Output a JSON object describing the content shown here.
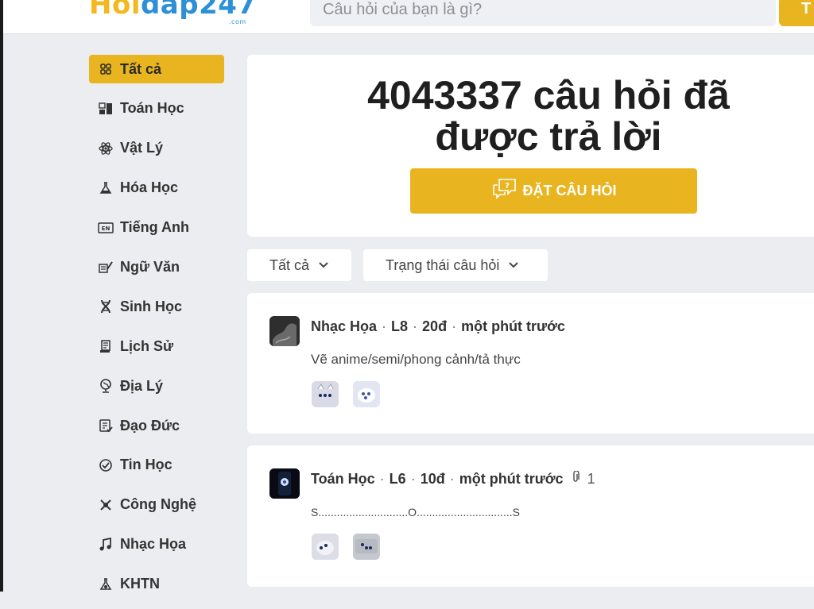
{
  "header": {
    "logo_part1": "Hoi",
    "logo_part2": "dap247",
    "logo_suffix": ".com",
    "search_placeholder": "Câu hỏi của bạn là gì?",
    "search_button_label": "T"
  },
  "sidebar": {
    "items": [
      {
        "label": "Tất cả",
        "icon": "grid-icon",
        "active": true
      },
      {
        "label": "Toán Học",
        "icon": "calculator-icon"
      },
      {
        "label": "Vật Lý",
        "icon": "atom-icon"
      },
      {
        "label": "Hóa Học",
        "icon": "flask-icon"
      },
      {
        "label": "Tiếng Anh",
        "icon": "english-icon"
      },
      {
        "label": "Ngữ Văn",
        "icon": "book-pen-icon"
      },
      {
        "label": "Sinh Học",
        "icon": "dna-icon"
      },
      {
        "label": "Lịch Sử",
        "icon": "scroll-icon"
      },
      {
        "label": "Địa Lý",
        "icon": "globe-icon"
      },
      {
        "label": "Đạo Đức",
        "icon": "ethics-icon"
      },
      {
        "label": "Tin Học",
        "icon": "computer-icon"
      },
      {
        "label": "Công Nghệ",
        "icon": "tech-icon"
      },
      {
        "label": "Nhạc Họa",
        "icon": "music-icon"
      },
      {
        "label": "KHTN",
        "icon": "science-icon"
      }
    ]
  },
  "hero": {
    "count_line1": "4043337 câu hỏi đã",
    "count_line2": "được trả lời",
    "ask_button": "ĐẶT CÂU HỎI"
  },
  "filters": {
    "subject": "Tất cả",
    "status": "Trạng thái câu hỏi"
  },
  "questions": [
    {
      "subject": "Nhạc Họa",
      "grade": "L8",
      "points": "20đ",
      "time": "một phút trước",
      "attachments": "",
      "text": "Vẽ anime/semi/phong cảnh/tả thực"
    },
    {
      "subject": "Toán Học",
      "grade": "L6",
      "points": "10đ",
      "time": "một phút trước",
      "attachments": "1",
      "text": "S.............................O...............................S"
    }
  ],
  "colors": {
    "accent": "#e8b41f",
    "background": "#ecedf0",
    "logo_yellow": "#f4b81e",
    "logo_blue": "#2d8fd5"
  }
}
